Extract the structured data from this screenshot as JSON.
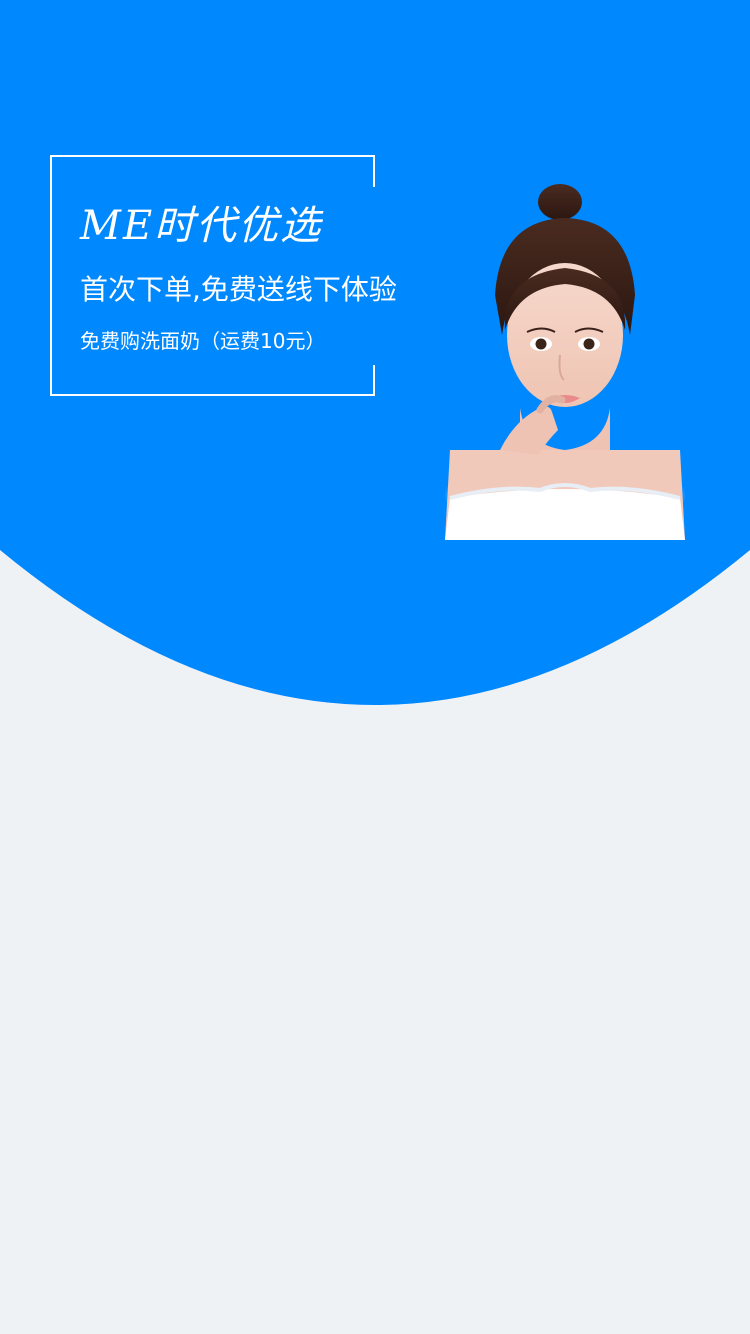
{
  "colors": {
    "brand_blue": "#0088ff",
    "page_background": "#eff2f5",
    "text": "#ffffff"
  },
  "promo": {
    "title": "ME时代优选",
    "headline": "首次下单,免费送线下体验",
    "subline": "免费购洗面奶（运费10元）"
  },
  "hero_image": {
    "icon": "model-portrait-icon"
  }
}
